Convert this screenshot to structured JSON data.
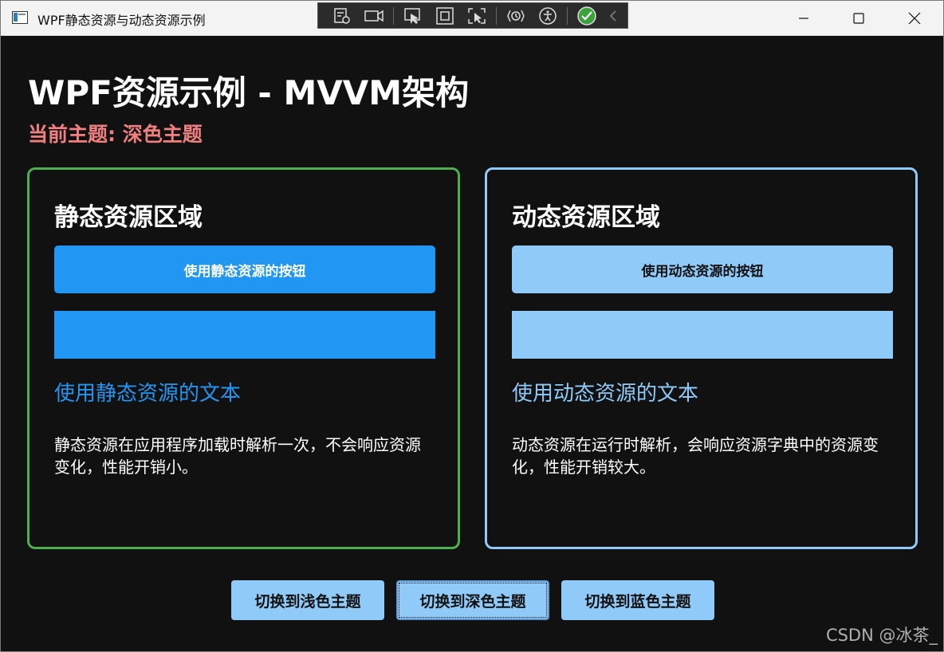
{
  "window": {
    "title": "WPF静态资源与动态资源示例",
    "app_icon": "window-app-icon",
    "controls": [
      "minimize-icon",
      "maximize-icon",
      "close-icon"
    ]
  },
  "debug_toolbar": {
    "icons": [
      "visual-tree-icon",
      "video-capture-icon",
      "select-element-icon",
      "display-layout-adorners-icon",
      "track-focus-icon",
      "hot-reload-icon",
      "accessibility-icon",
      "binding-check-icon",
      "collapse-chevron-icon"
    ]
  },
  "header": {
    "title": "WPF资源示例 - MVVM架构",
    "current_theme": "当前主题: 深色主题"
  },
  "panels": {
    "static": {
      "title": "静态资源区域",
      "button_label": "使用静态资源的按钮",
      "text": "使用静态资源的文本",
      "description": "静态资源在应用程序加载时解析一次，不会响应资源变化，性能开销小。",
      "accent_color": "#2196f3",
      "border_color": "#4caf50"
    },
    "dynamic": {
      "title": "动态资源区域",
      "button_label": "使用动态资源的按钮",
      "text": "使用动态资源的文本",
      "description": "动态资源在运行时解析，会响应资源字典中的资源变化，性能开销较大。",
      "accent_color": "#90caf9",
      "border_color": "#90caf9"
    }
  },
  "theme_buttons": [
    {
      "label": "切换到浅色主题",
      "focused": false
    },
    {
      "label": "切换到深色主题",
      "focused": true
    },
    {
      "label": "切换到蓝色主题",
      "focused": false
    }
  ],
  "watermark": "CSDN @冰茶_",
  "colors": {
    "background": "#111111",
    "theme_label": "#f08080",
    "button_primary": "#90caf9"
  }
}
